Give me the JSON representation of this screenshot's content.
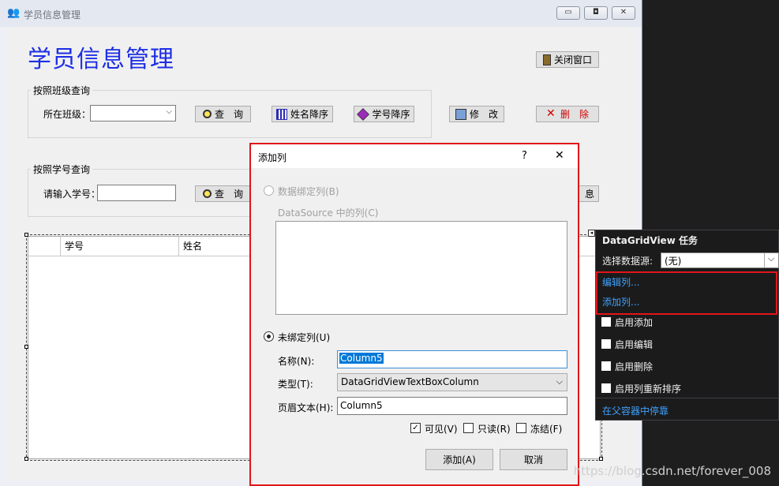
{
  "form": {
    "title": "学员信息管理",
    "heading": "学员信息管理",
    "close_window_label": "关闭窗口",
    "class_group": {
      "title": "按照班级查询",
      "class_label": "所在班级：",
      "class_value": "",
      "query_label": "查　询",
      "sort_name_label": "姓名降序",
      "sort_id_label": "学号降序"
    },
    "edit_label": "修　改",
    "delete_label": "删　除",
    "id_group": {
      "title": "按照学号查询",
      "id_label": "请输入学号：",
      "id_value": "",
      "query_label": "查　询",
      "partial_info_label": "息"
    },
    "grid": {
      "columns": [
        "学号",
        "姓名"
      ]
    }
  },
  "dialog": {
    "title": "添加列",
    "help": "?",
    "close": "✕",
    "bound_column_label": "数据绑定列(B)",
    "datasource_columns_label": "DataSource 中的列(C)",
    "unbound_column_label": "未绑定列(U)",
    "name_label": "名称(N):",
    "name_value": "Column5",
    "type_label": "类型(T):",
    "type_value": "DataGridViewTextBoxColumn",
    "header_text_label": "页眉文本(H):",
    "header_text_value": "Column5",
    "visible_label": "可见(V)",
    "readonly_label": "只读(R)",
    "frozen_label": "冻结(F)",
    "visible_checked": true,
    "readonly_checked": false,
    "frozen_checked": false,
    "add_button": "添加(A)",
    "cancel_button": "取消"
  },
  "tasks": {
    "title": "DataGridView 任务",
    "datasource_label": "选择数据源:",
    "datasource_value": "(无)",
    "edit_columns": "编辑列...",
    "add_column": "添加列...",
    "enable_add": "启用添加",
    "enable_edit": "启用编辑",
    "enable_delete": "启用删除",
    "enable_reorder": "启用列重新排序",
    "dock": "在父容器中停靠"
  },
  "watermark": "https://blog.csdn.net/forever_008",
  "colors": {
    "title_blue": "#1d2ee6",
    "highlight_red": "#e0161a",
    "link_blue": "#3ea2ff",
    "selection_blue": "#0078d7"
  }
}
